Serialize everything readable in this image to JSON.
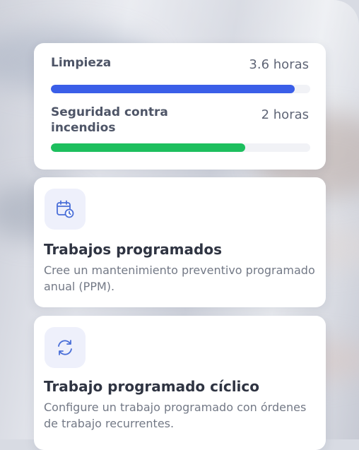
{
  "metrics": [
    {
      "label": "Limpieza",
      "value": "3.6 horas",
      "progress": 0.94,
      "color": "#3a5ee8"
    },
    {
      "label": "Seguridad contra incendios",
      "value": "2 horas",
      "progress": 0.75,
      "color": "#1dbf5e"
    }
  ],
  "features": [
    {
      "icon": "calendar-clock-icon",
      "title": "Trabajos programados",
      "description": "Cree un mantenimiento preventivo programado anual (PPM)."
    },
    {
      "icon": "refresh-cycle-icon",
      "title": "Trabajo programado cíclico",
      "description": "Configure un trabajo programado con órdenes de trabajo recurrentes."
    }
  ]
}
